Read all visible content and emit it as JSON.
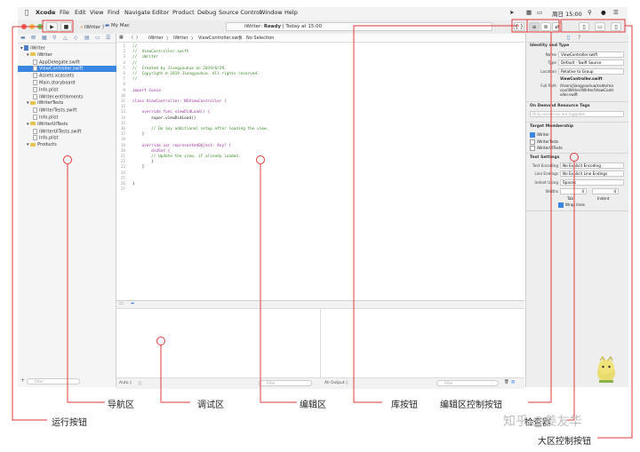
{
  "menubar": {
    "items": [
      "Xcode",
      "File",
      "Edit",
      "View",
      "Find",
      "Navigate",
      "Editor",
      "Product",
      "Debug",
      "Source Control",
      "Window",
      "Help"
    ],
    "clock": "周日 15:00"
  },
  "toolbar": {
    "run_icon": "play-icon",
    "stop_icon": "stop-icon",
    "scheme": "iWriter",
    "destination": "My Mac",
    "status_project": "iWriter",
    "status_text": "Ready",
    "status_time": "Today at 15:00"
  },
  "navigator": {
    "items": [
      {
        "label": "iWriter",
        "kind": "project",
        "indent": 0
      },
      {
        "label": "iWriter",
        "kind": "folder",
        "indent": 1
      },
      {
        "label": "AppDelegate.swift",
        "kind": "file",
        "indent": 2
      },
      {
        "label": "ViewController.swift",
        "kind": "file",
        "indent": 2,
        "selected": true
      },
      {
        "label": "Assets.xcassets",
        "kind": "file",
        "indent": 2
      },
      {
        "label": "Main.storyboard",
        "kind": "file",
        "indent": 2
      },
      {
        "label": "Info.plist",
        "kind": "file",
        "indent": 2
      },
      {
        "label": "iWriter.entitlements",
        "kind": "file",
        "indent": 2
      },
      {
        "label": "iWriterTests",
        "kind": "folder",
        "indent": 1
      },
      {
        "label": "iWriterTests.swift",
        "kind": "file",
        "indent": 2
      },
      {
        "label": "Info.plist",
        "kind": "file",
        "indent": 2
      },
      {
        "label": "iWriterUITests",
        "kind": "folder",
        "indent": 1
      },
      {
        "label": "iWriterUITests.swift",
        "kind": "file",
        "indent": 2
      },
      {
        "label": "Info.plist",
        "kind": "file",
        "indent": 2
      },
      {
        "label": "Products",
        "kind": "folder",
        "indent": 1
      }
    ],
    "filter_placeholder": "Filter"
  },
  "editor": {
    "jumpbar": [
      "iWriter",
      "iWriter",
      "ViewController.swift",
      "No Selection"
    ],
    "lines": [
      {
        "n": "1",
        "t": "//",
        "c": "comment"
      },
      {
        "n": "2",
        "t": "//  ViewController.swift",
        "c": "comment"
      },
      {
        "n": "3",
        "t": "//  iWriter",
        "c": "comment"
      },
      {
        "n": "4",
        "t": "//",
        "c": "comment"
      },
      {
        "n": "5",
        "t": "//  Created by Jiangyouhua on 2019/6/29.",
        "c": "comment"
      },
      {
        "n": "6",
        "t": "//  Copyright © 2019 Jiangyouhua. All rights reserved.",
        "c": "comment"
      },
      {
        "n": "7",
        "t": "//",
        "c": "comment"
      },
      {
        "n": "8",
        "t": "",
        "c": ""
      },
      {
        "n": "9",
        "t": "import Cocoa",
        "c": "kw"
      },
      {
        "n": "10",
        "t": "",
        "c": ""
      },
      {
        "n": "11",
        "t": "class ViewController: NSViewController {",
        "c": "kw"
      },
      {
        "n": "12",
        "t": "",
        "c": ""
      },
      {
        "n": "13",
        "t": "    override func viewDidLoad() {",
        "c": "kw"
      },
      {
        "n": "14",
        "t": "        super.viewDidLoad()",
        "c": ""
      },
      {
        "n": "15",
        "t": "",
        "c": ""
      },
      {
        "n": "16",
        "t": "        // Do any additional setup after loading the view.",
        "c": "comment"
      },
      {
        "n": "17",
        "t": "    }",
        "c": ""
      },
      {
        "n": "18",
        "t": "",
        "c": ""
      },
      {
        "n": "19",
        "t": "    override var representedObject: Any? {",
        "c": "kw"
      },
      {
        "n": "20",
        "t": "        didSet {",
        "c": "kw"
      },
      {
        "n": "21",
        "t": "        // Update the view, if already loaded.",
        "c": "comment"
      },
      {
        "n": "22",
        "t": "        }",
        "c": ""
      },
      {
        "n": "23",
        "t": "    }",
        "c": ""
      },
      {
        "n": "24",
        "t": "",
        "c": ""
      },
      {
        "n": "25",
        "t": "",
        "c": ""
      },
      {
        "n": "26",
        "t": "}",
        "c": ""
      },
      {
        "n": "27",
        "t": "",
        "c": ""
      }
    ]
  },
  "debug": {
    "auto_label": "Auto ◊",
    "output_label": "All Output ◊",
    "filter_placeholder": "Filter"
  },
  "inspector": {
    "identity_title": "Identity and Type",
    "name_label": "Name",
    "name_value": "ViewController.swift",
    "type_label": "Type",
    "type_value": "Default - Swift Source",
    "location_label": "Location",
    "location_value": "Relative to Group",
    "location_file": "ViewController.swift",
    "fullpath_label": "Full Path",
    "fullpath_value": "/Users/jiangyouhua/code/macos/iWriter/iWriter/ViewController.swift",
    "odr_title": "On Demand Resource Tags",
    "odr_placeholder": "Only resources are taggable",
    "target_title": "Target Membership",
    "targets": [
      {
        "label": "iWriter",
        "checked": true
      },
      {
        "label": "iWriterTests",
        "checked": false
      },
      {
        "label": "iWriterUITests",
        "checked": false
      }
    ],
    "text_title": "Text Settings",
    "encoding_label": "Text Encoding",
    "encoding_value": "No Explicit Encoding",
    "endings_label": "Line Endings",
    "endings_value": "No Explicit Line Endings",
    "indent_label": "Indent Using",
    "indent_value": "Spaces",
    "widths_label": "Widths",
    "tab_value": "4",
    "indent_num": "4",
    "tab_caption": "Tab",
    "indent_caption": "Indent",
    "wrap_label": "Wrap lines"
  },
  "annotations": {
    "run": "运行按钮",
    "navigator": "导航区",
    "debug": "调试区",
    "editor": "编辑区",
    "library": "库按钮",
    "editor_ctrl": "编辑区控制按钮",
    "inspector": "检查器",
    "area_ctrl": "大区控制按钮",
    "color": "#e03a3a"
  },
  "watermark": "知乎 @姜友华"
}
